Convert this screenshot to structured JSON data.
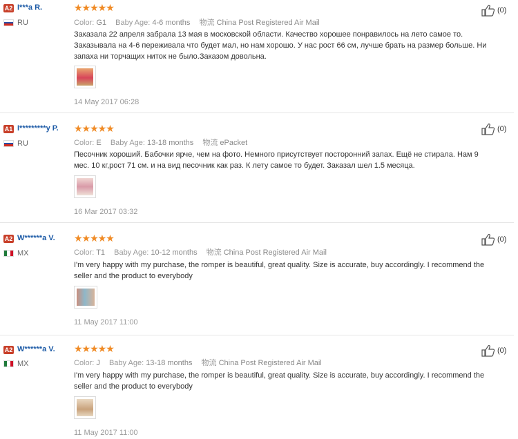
{
  "reviews": [
    {
      "badge": "A2",
      "buyer": "I***a R.",
      "country": "RU",
      "stars": "★★★★★",
      "color_label": "Color:",
      "color_value": "G1",
      "age_label": "Baby Age:",
      "age_value": "4-6 months",
      "shipping_label": "物流",
      "shipping_value": "China Post Registered Air Mail",
      "comment": "Заказала 22 апреля забрала 13 мая в московской области. Качество хорошее понравилось на лето самое то. Заказывала на 4-6 переживала что будет мал, но нам хорошо. У нас рост 66 см, лучше брать на размер больше. Ни запаха ни торчащих ниток не было.Заказом довольна.",
      "date": "14 May 2017 06:28",
      "helpful": "(0)"
    },
    {
      "badge": "A1",
      "buyer": "I*********y P.",
      "country": "RU",
      "stars": "★★★★★",
      "color_label": "Color:",
      "color_value": "E",
      "age_label": "Baby Age:",
      "age_value": "13-18 months",
      "shipping_label": "物流",
      "shipping_value": "ePacket",
      "comment": "Песочник хороший. Бабочки ярче, чем на фото. Немного присутствует посторонний запах. Ещё не стирала. Нам 9 мес. 10 кг,рост 71 см. и на вид песочник как раз. К лету самое то будет. Заказал шел 1.5 месяца.",
      "date": "16 Mar 2017 03:32",
      "helpful": "(0)"
    },
    {
      "badge": "A2",
      "buyer": "W******a V.",
      "country": "MX",
      "stars": "★★★★★",
      "color_label": "Color:",
      "color_value": "T1",
      "age_label": "Baby Age:",
      "age_value": "10-12 months",
      "shipping_label": "物流",
      "shipping_value": "China Post Registered Air Mail",
      "comment": "I'm very happy with my purchase, the romper is beautiful, great quality. Size is accurate, buy accordingly. I recommend the seller and the product to everybody",
      "date": "11 May 2017 11:00",
      "helpful": "(0)"
    },
    {
      "badge": "A2",
      "buyer": "W******a V.",
      "country": "MX",
      "stars": "★★★★★",
      "color_label": "Color:",
      "color_value": "J",
      "age_label": "Baby Age:",
      "age_value": "13-18 months",
      "shipping_label": "物流",
      "shipping_value": "China Post Registered Air Mail",
      "comment": "I'm very happy with my purchase, the romper is beautiful, great quality. Size is accurate, buy accordingly. I recommend the seller and the product to everybody",
      "date": "11 May 2017 11:00",
      "helpful": "(0)"
    }
  ],
  "colors": {
    "buyer_link": "#1c5aa6",
    "badge": "#c8402a",
    "star": "#f08a24"
  }
}
